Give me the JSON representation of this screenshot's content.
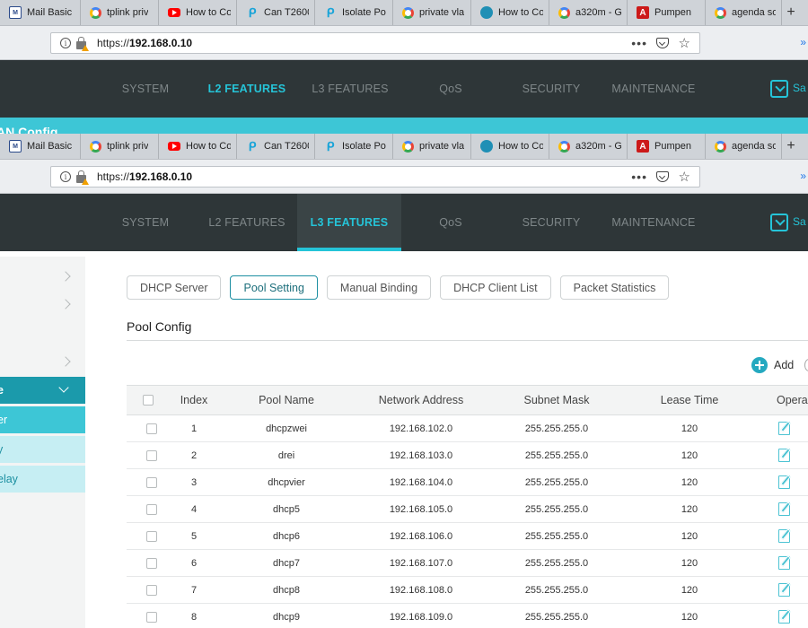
{
  "browser": {
    "tabs": [
      {
        "label": "Mail Basic",
        "icon": "mail-icon"
      },
      {
        "label": "tplink priv",
        "icon": "google-icon"
      },
      {
        "label": "How to Co",
        "icon": "youtube-icon"
      },
      {
        "label": "Can T2600",
        "icon": "tplink-icon"
      },
      {
        "label": "Isolate Po",
        "icon": "tplink-icon"
      },
      {
        "label": "private vla",
        "icon": "google-icon"
      },
      {
        "label": "How to Co",
        "icon": "shield-icon"
      },
      {
        "label": "a320m - G",
        "icon": "google-icon"
      },
      {
        "label": "Pumpen",
        "icon": "adobe-icon"
      },
      {
        "label": "agenda so",
        "icon": "google-icon"
      }
    ],
    "new_tab": "+",
    "url_prefix": "https://",
    "url_host": "192.168.0.10",
    "more_menu": "•••",
    "info_glyph": "i",
    "right_glyph": "»"
  },
  "nav_back": {
    "items": [
      "SYSTEM",
      "L2 FEATURES",
      "L3 FEATURES",
      "QoS",
      "SECURITY",
      "MAINTENANCE"
    ],
    "strong_index": 1,
    "save": "Sa",
    "strip_title": "AN Config"
  },
  "nav": {
    "items": [
      "SYSTEM",
      "L2 FEATURES",
      "L3 FEATURES",
      "QoS",
      "SECURITY",
      "MAINTENANCE"
    ],
    "active_index": 2,
    "save": "Sa"
  },
  "sidebar": {
    "group_label": "e",
    "selected_label": "er",
    "sub_items": [
      "y",
      "elay"
    ]
  },
  "subtabs": [
    "DHCP Server",
    "Pool Setting",
    "Manual Binding",
    "DHCP Client List",
    "Packet Statistics"
  ],
  "active_subtab": "Pool Setting",
  "section_title": "Pool Config",
  "add_label": "Add",
  "table": {
    "headers": [
      "Index",
      "Pool Name",
      "Network Address",
      "Subnet Mask",
      "Lease Time",
      "Opera"
    ],
    "rows": [
      {
        "index": "1",
        "name": "dhcpzwei",
        "network": "192.168.102.0",
        "mask": "255.255.255.0",
        "lease": "120"
      },
      {
        "index": "2",
        "name": "drei",
        "network": "192.168.103.0",
        "mask": "255.255.255.0",
        "lease": "120"
      },
      {
        "index": "3",
        "name": "dhcpvier",
        "network": "192.168.104.0",
        "mask": "255.255.255.0",
        "lease": "120"
      },
      {
        "index": "4",
        "name": "dhcp5",
        "network": "192.168.105.0",
        "mask": "255.255.255.0",
        "lease": "120"
      },
      {
        "index": "5",
        "name": "dhcp6",
        "network": "192.168.106.0",
        "mask": "255.255.255.0",
        "lease": "120"
      },
      {
        "index": "6",
        "name": "dhcp7",
        "network": "192.168.107.0",
        "mask": "255.255.255.0",
        "lease": "120"
      },
      {
        "index": "7",
        "name": "dhcp8",
        "network": "192.168.108.0",
        "mask": "255.255.255.0",
        "lease": "120"
      },
      {
        "index": "8",
        "name": "dhcp9",
        "network": "192.168.109.0",
        "mask": "255.255.255.0",
        "lease": "120"
      }
    ]
  },
  "colors": {
    "accent": "#25c4d8",
    "nav_bg": "#2e3638",
    "sidebar_group": "#1b9aab"
  }
}
